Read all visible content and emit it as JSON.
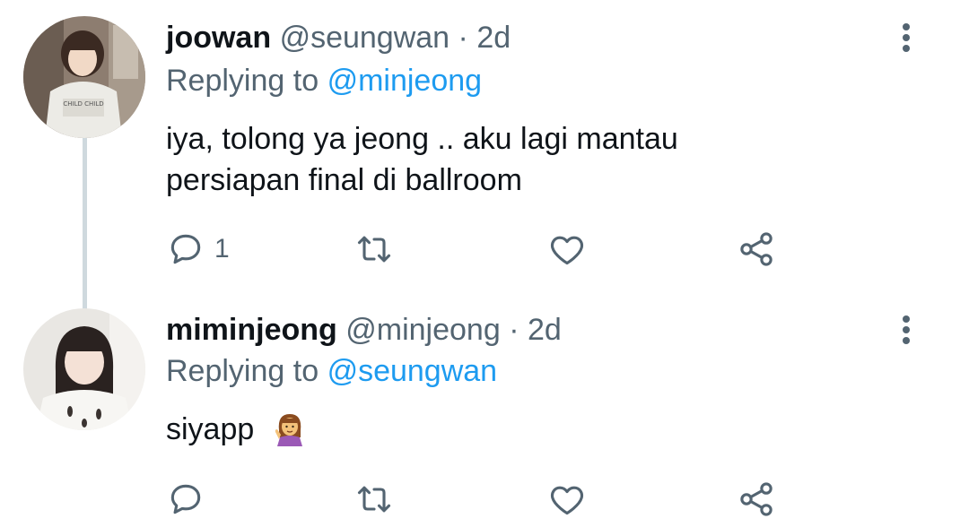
{
  "tweets": [
    {
      "display_name": "joowan",
      "handle": "@seungwan",
      "separator": "·",
      "time": "2d",
      "replying_label": "Replying to",
      "replying_to": "@minjeong",
      "text_line1": "iya, tolong ya jeong .. aku lagi mantau",
      "text_line2": "persiapan final di ballroom",
      "reply_count": "1",
      "avatar_shirt_text": "CHILD CHILD"
    },
    {
      "display_name": "miminjeong",
      "handle": "@minjeong",
      "separator": "·",
      "time": "2d",
      "replying_label": "Replying to",
      "replying_to": "@seungwan",
      "text": "siyapp",
      "emoji": "woman-tipping-hand-emoji",
      "reply_count": ""
    }
  ],
  "icons": {
    "more": "more-vertical-icon",
    "reply": "reply-icon",
    "retweet": "retweet-icon",
    "like": "heart-icon",
    "share": "share-icon"
  },
  "colors": {
    "text_primary": "#0f1419",
    "text_secondary": "#536471",
    "mention": "#1d9bf0",
    "thread_line": "#cfd9de"
  }
}
